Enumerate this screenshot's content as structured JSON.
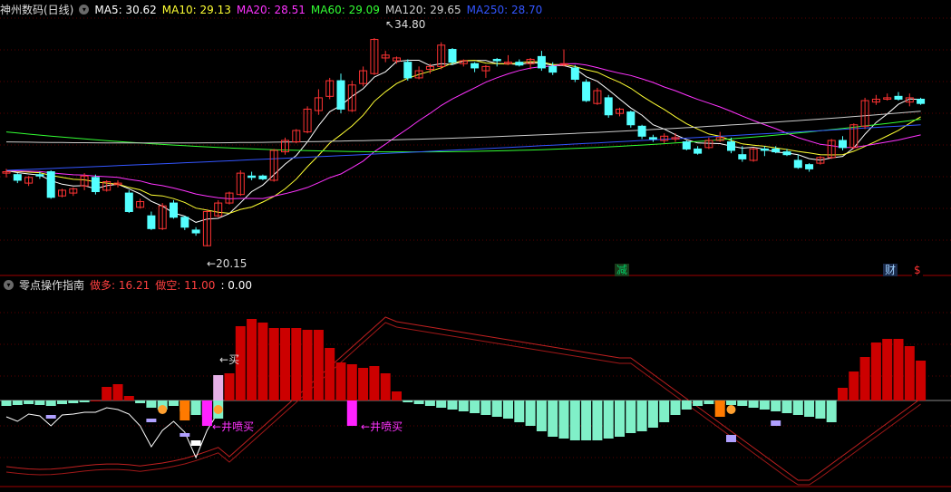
{
  "top_header": {
    "title": "神州数码(日线)",
    "ma": [
      {
        "label": "MA5: 30.62",
        "color": "#ffffff"
      },
      {
        "label": "MA10: 29.13",
        "color": "#ffff33"
      },
      {
        "label": "MA20: 28.51",
        "color": "#ff33ff"
      },
      {
        "label": "MA60: 29.09",
        "color": "#33ff33"
      },
      {
        "label": "MA120: 29.65",
        "color": "#cccccc"
      },
      {
        "label": "MA250: 28.70",
        "color": "#3355ff"
      }
    ]
  },
  "price_labels": {
    "high": "34.80",
    "low": "20.15"
  },
  "event_tags": [
    {
      "text": "减",
      "color": "#00cc66",
      "bg": "#1a3a1a"
    },
    {
      "text": "财",
      "color": "#9fd0ff",
      "bg": "#1a2a4a"
    },
    {
      "text": "$",
      "color": "#ff3333",
      "bg": "#000000"
    }
  ],
  "bottom_header": {
    "title": "零点操作指南",
    "items": [
      {
        "label": "做多: 16.21",
        "color": "#ff4040"
      },
      {
        "label": "做空: 11.00",
        "color": "#ff4040"
      },
      {
        "label": ": 0.00",
        "color": "#ffffff"
      }
    ]
  },
  "signals": {
    "buy": "买",
    "well_buy_1": "井喷买",
    "well_buy_2": "井喷买"
  },
  "colors": {
    "up": "#ff3333",
    "down": "#54ffff",
    "bull": "#cc0000",
    "bear": "#80f0c8",
    "grid": "#5a0000"
  },
  "chart_data": {
    "type": "candlestick",
    "candles": [
      [
        25.3,
        25.6,
        25.0,
        25.4
      ],
      [
        25.2,
        25.3,
        24.6,
        24.8
      ],
      [
        24.6,
        25.1,
        24.4,
        25.0
      ],
      [
        25.2,
        25.4,
        24.9,
        25.1
      ],
      [
        25.4,
        25.5,
        23.5,
        23.6
      ],
      [
        23.7,
        24.2,
        23.6,
        24.1
      ],
      [
        23.9,
        24.3,
        23.7,
        24.2
      ],
      [
        24.4,
        25.3,
        24.1,
        25.1
      ],
      [
        25.0,
        25.2,
        23.8,
        24.0
      ],
      [
        24.1,
        24.8,
        24.0,
        24.7
      ],
      [
        24.5,
        24.8,
        24.3,
        24.6
      ],
      [
        23.9,
        24.1,
        22.5,
        22.6
      ],
      [
        22.9,
        23.5,
        22.8,
        23.3
      ],
      [
        22.3,
        22.6,
        21.3,
        21.4
      ],
      [
        21.4,
        23.2,
        21.3,
        23.0
      ],
      [
        23.2,
        23.4,
        22.1,
        22.2
      ],
      [
        22.2,
        22.3,
        21.3,
        21.5
      ],
      [
        21.3,
        21.5,
        20.9,
        21.1
      ],
      [
        20.2,
        22.7,
        20.15,
        22.6
      ],
      [
        22.3,
        23.4,
        22.2,
        23.2
      ],
      [
        23.2,
        24.0,
        23.1,
        23.9
      ],
      [
        23.8,
        25.5,
        23.7,
        25.3
      ],
      [
        25.1,
        25.4,
        24.8,
        25.0
      ],
      [
        25.1,
        25.2,
        24.8,
        24.9
      ],
      [
        24.8,
        27.0,
        24.7,
        26.9
      ],
      [
        26.8,
        27.8,
        26.6,
        27.6
      ],
      [
        27.5,
        28.4,
        27.4,
        28.3
      ],
      [
        28.2,
        30.0,
        28.1,
        29.8
      ],
      [
        29.7,
        31.2,
        29.4,
        30.6
      ],
      [
        30.7,
        32.0,
        30.5,
        31.8
      ],
      [
        31.8,
        32.3,
        29.5,
        29.8
      ],
      [
        29.7,
        31.8,
        29.6,
        31.5
      ],
      [
        31.6,
        32.8,
        31.4,
        32.5
      ],
      [
        32.3,
        34.8,
        32.2,
        34.7
      ],
      [
        33.4,
        33.9,
        33.1,
        33.6
      ],
      [
        33.2,
        33.5,
        33.0,
        33.4
      ],
      [
        33.1,
        33.3,
        31.8,
        32.0
      ],
      [
        32.0,
        32.8,
        31.9,
        32.5
      ],
      [
        32.6,
        33.0,
        32.3,
        32.8
      ],
      [
        32.8,
        34.5,
        32.6,
        34.3
      ],
      [
        34.0,
        34.1,
        32.9,
        33.1
      ],
      [
        33.0,
        33.3,
        32.8,
        33.2
      ],
      [
        33.0,
        33.1,
        32.4,
        32.7
      ],
      [
        32.5,
        32.9,
        32.0,
        32.8
      ],
      [
        33.3,
        33.4,
        32.8,
        33.2
      ],
      [
        33.0,
        33.6,
        32.9,
        33.1
      ],
      [
        33.1,
        33.3,
        32.8,
        32.9
      ],
      [
        33.0,
        33.4,
        32.6,
        33.3
      ],
      [
        33.5,
        33.9,
        32.5,
        32.7
      ],
      [
        32.8,
        33.1,
        32.2,
        32.4
      ],
      [
        32.9,
        34.0,
        32.8,
        33.0
      ],
      [
        32.7,
        32.9,
        31.7,
        31.9
      ],
      [
        31.7,
        31.9,
        30.3,
        30.4
      ],
      [
        30.2,
        31.3,
        30.1,
        31.1
      ],
      [
        30.6,
        30.8,
        29.2,
        29.4
      ],
      [
        29.5,
        29.9,
        29.3,
        29.8
      ],
      [
        29.6,
        29.7,
        28.5,
        28.7
      ],
      [
        28.6,
        28.7,
        27.7,
        27.9
      ],
      [
        27.8,
        28.0,
        27.5,
        27.7
      ],
      [
        27.6,
        28.1,
        27.4,
        27.9
      ],
      [
        27.7,
        28.1,
        27.5,
        27.8
      ],
      [
        27.5,
        27.6,
        26.9,
        27.0
      ],
      [
        27.0,
        27.2,
        26.6,
        26.7
      ],
      [
        27.1,
        27.8,
        27.0,
        27.6
      ],
      [
        27.6,
        28.2,
        27.5,
        27.8
      ],
      [
        27.5,
        27.8,
        26.7,
        26.9
      ],
      [
        26.6,
        27.2,
        26.1,
        26.3
      ],
      [
        26.2,
        27.1,
        26.1,
        27.0
      ],
      [
        27.0,
        27.2,
        26.5,
        26.9
      ],
      [
        27.0,
        27.2,
        26.7,
        26.8
      ],
      [
        26.8,
        27.0,
        26.5,
        26.6
      ],
      [
        26.2,
        26.6,
        25.6,
        25.7
      ],
      [
        25.9,
        26.0,
        25.4,
        25.6
      ],
      [
        26.0,
        26.5,
        25.9,
        26.4
      ],
      [
        26.4,
        27.7,
        26.3,
        27.6
      ],
      [
        27.6,
        27.9,
        26.9,
        27.1
      ],
      [
        27.1,
        28.8,
        27.0,
        28.7
      ],
      [
        28.6,
        30.6,
        28.4,
        30.4
      ],
      [
        30.3,
        30.8,
        30.1,
        30.5
      ],
      [
        30.5,
        30.9,
        30.4,
        30.6
      ],
      [
        30.7,
        31.0,
        30.4,
        30.5
      ],
      [
        30.3,
        30.9,
        30.0,
        30.6
      ],
      [
        30.5,
        30.6,
        30.1,
        30.2
      ]
    ],
    "ma_periods": [
      5,
      10,
      20,
      60,
      120,
      250
    ],
    "ma_last": {
      "MA5": 30.62,
      "MA10": 29.13,
      "MA20": 28.51,
      "MA60": 29.09,
      "MA120": 29.65,
      "MA250": 28.7
    },
    "indicator_bars": [
      -6,
      -5,
      -4,
      -5,
      -6,
      -4,
      -3,
      -2,
      0,
      15,
      18,
      5,
      -3,
      -8,
      -10,
      -6,
      -12,
      -16,
      -18,
      -20,
      30,
      82,
      90,
      86,
      80,
      80,
      80,
      78,
      78,
      58,
      42,
      40,
      36,
      38,
      30,
      10,
      -2,
      -4,
      -6,
      -8,
      -10,
      -12,
      -14,
      -16,
      -18,
      -20,
      -24,
      -28,
      -34,
      -40,
      -42,
      -44,
      -44,
      -44,
      -42,
      -40,
      -36,
      -34,
      -30,
      -24,
      -16,
      -10,
      -6,
      -4,
      -4,
      -5,
      -6,
      -8,
      -10,
      -12,
      -14,
      -16,
      -18,
      -20,
      -24,
      14,
      32,
      48,
      64,
      68,
      68,
      60,
      44
    ]
  }
}
